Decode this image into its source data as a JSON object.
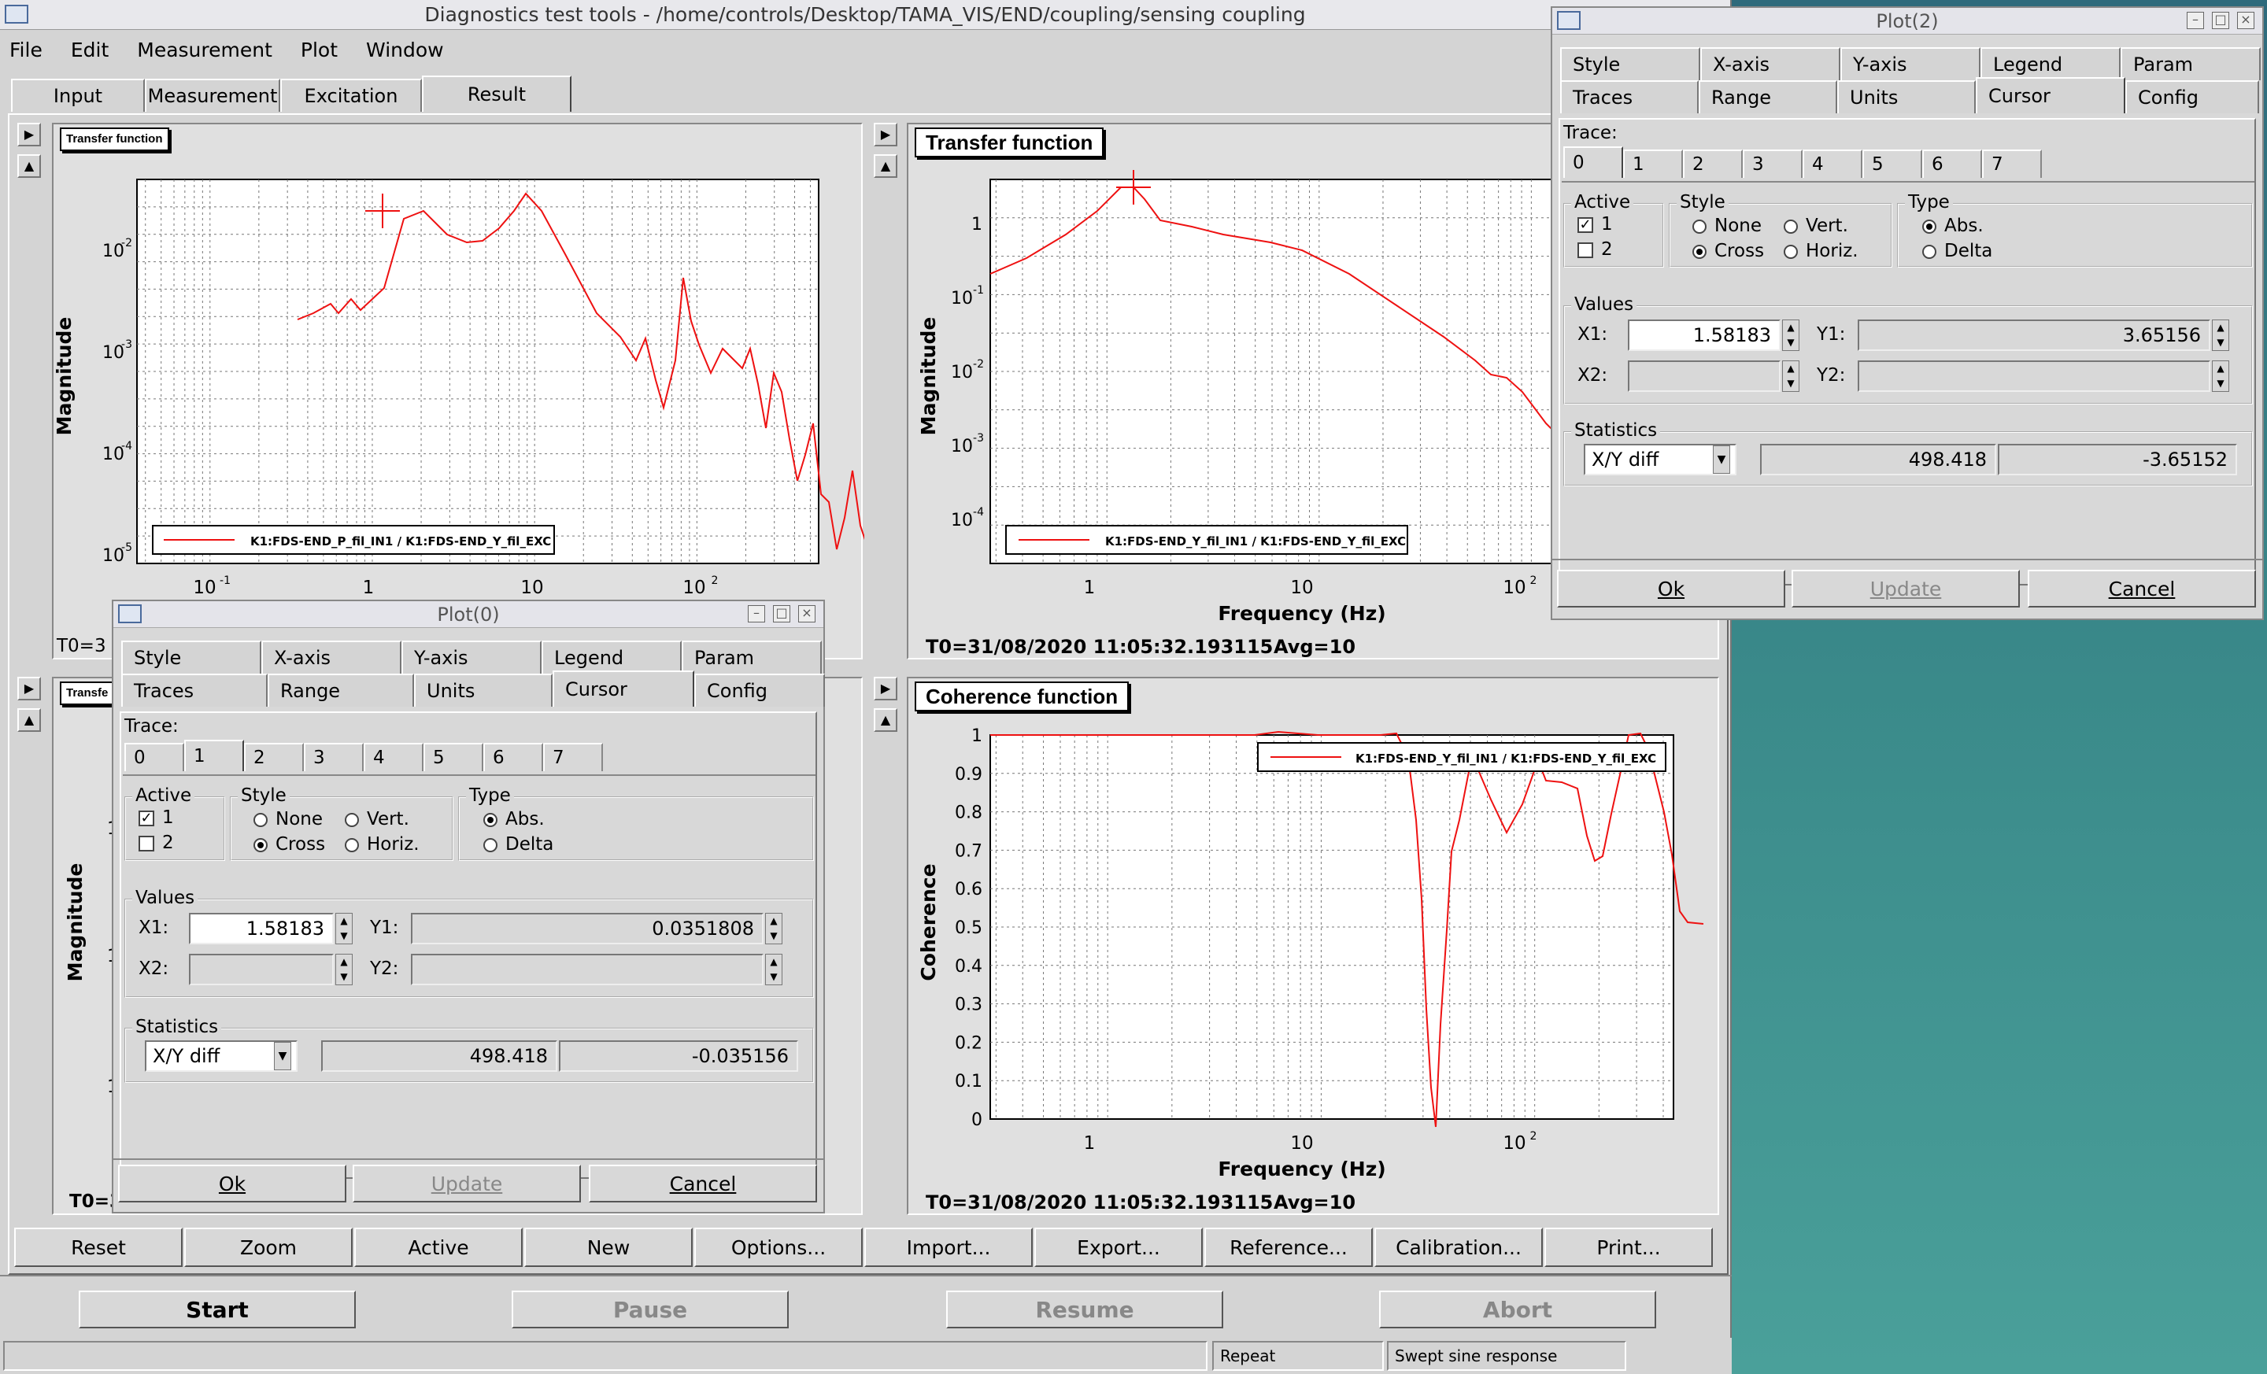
{
  "window": {
    "title": "Diagnostics test tools - /home/controls/Desktop/TAMA_VIS/END/coupling/sensing coupling"
  },
  "menu": [
    "File",
    "Edit",
    "Measurement",
    "Plot",
    "Window"
  ],
  "main_tabs": [
    "Input",
    "Measurement",
    "Excitation",
    "Result"
  ],
  "panels": {
    "tl": {
      "title": "Transfer function",
      "ylabel": "Magnitude",
      "legend": "K1:FDS-END_P_fil_IN1 / K1:FDS-END_Y_fil_EXC",
      "footer": "T0=3"
    },
    "tr": {
      "title": "Transfer function",
      "ylabel": "Magnitude",
      "xlabel": "Frequency (Hz)",
      "legend": "K1:FDS-END_Y_fil_IN1 / K1:FDS-END_Y_fil_EXC",
      "t0": "T0=31/08/2020 11:05:32.193115",
      "avg": "Avg=10"
    },
    "bl": {
      "title": "Transfe",
      "ylabel": "Magnitude",
      "footer": "T0=3"
    },
    "br": {
      "title": "Coherence function",
      "ylabel": "Coherence",
      "xlabel": "Frequency (Hz)",
      "legend": "K1:FDS-END_Y_fil_IN1 / K1:FDS-END_Y_fil_EXC",
      "t0": "T0=31/08/2020 11:05:32.193115",
      "avg": "Avg=10"
    }
  },
  "bottom_buttons": [
    "Reset",
    "Zoom",
    "Active",
    "New",
    "Options...",
    "Import...",
    "Export...",
    "Reference...",
    "Calibration...",
    "Print..."
  ],
  "control_buttons": {
    "start": "Start",
    "pause": "Pause",
    "resume": "Resume",
    "abort": "Abort"
  },
  "status": {
    "repeat": "Repeat",
    "mode": "Swept sine response"
  },
  "dialog_common": {
    "tabs_row1": [
      "Style",
      "X-axis",
      "Y-axis",
      "Legend",
      "Param"
    ],
    "tabs_row2": [
      "Traces",
      "Range",
      "Units",
      "Cursor",
      "Config"
    ],
    "trace_label": "Trace:",
    "traces": [
      "0",
      "1",
      "2",
      "3",
      "4",
      "5",
      "6",
      "7"
    ],
    "active_label": "Active",
    "active_1": "1",
    "active_2": "2",
    "style_label": "Style",
    "style_none": "None",
    "style_vert": "Vert.",
    "style_cross": "Cross",
    "style_horiz": "Horiz.",
    "type_label": "Type",
    "type_abs": "Abs.",
    "type_delta": "Delta",
    "values_label": "Values",
    "x1_label": "X1:",
    "x2_label": "X2:",
    "y1_label": "Y1:",
    "y2_label": "Y2:",
    "statistics_label": "Statistics",
    "stat_mode": "X/Y diff",
    "ok": "Ok",
    "update": "Update",
    "cancel": "Cancel"
  },
  "plot0": {
    "title": "Plot(0)",
    "x1": "1.58183",
    "y1": "0.0351808",
    "stat_x": "498.418",
    "stat_y": "-0.035156"
  },
  "plot2": {
    "title": "Plot(2)",
    "x1": "1.58183",
    "y1": "3.65156",
    "stat_x": "498.418",
    "stat_y": "-3.65152"
  },
  "axes": {
    "tl_x": [
      "10",
      "1",
      "10",
      "10",
      "10"
    ],
    "tl_x_exp": [
      "-1",
      "",
      "",
      "2",
      ""
    ],
    "tl_y": [
      "10",
      "10",
      "10",
      "10"
    ],
    "tl_y_exp": [
      "-2",
      "-3",
      "-4",
      "-5"
    ],
    "tr_x": [
      "1",
      "10",
      "10"
    ],
    "tr_x_exp": [
      "",
      "",
      "2"
    ],
    "tr_y": [
      "1",
      "10",
      "10",
      "10",
      "10"
    ],
    "tr_y_exp": [
      "",
      "-1",
      "-2",
      "-3",
      "-4"
    ],
    "br_y": [
      "1",
      "0.9",
      "0.8",
      "0.7",
      "0.6",
      "0.5",
      "0.4",
      "0.3",
      "0.2",
      "0.1",
      "0"
    ],
    "bl_y": [
      "10",
      "10",
      "10"
    ]
  },
  "colors": {
    "trace": "#ee1111",
    "teal": "#3e8f8c"
  }
}
